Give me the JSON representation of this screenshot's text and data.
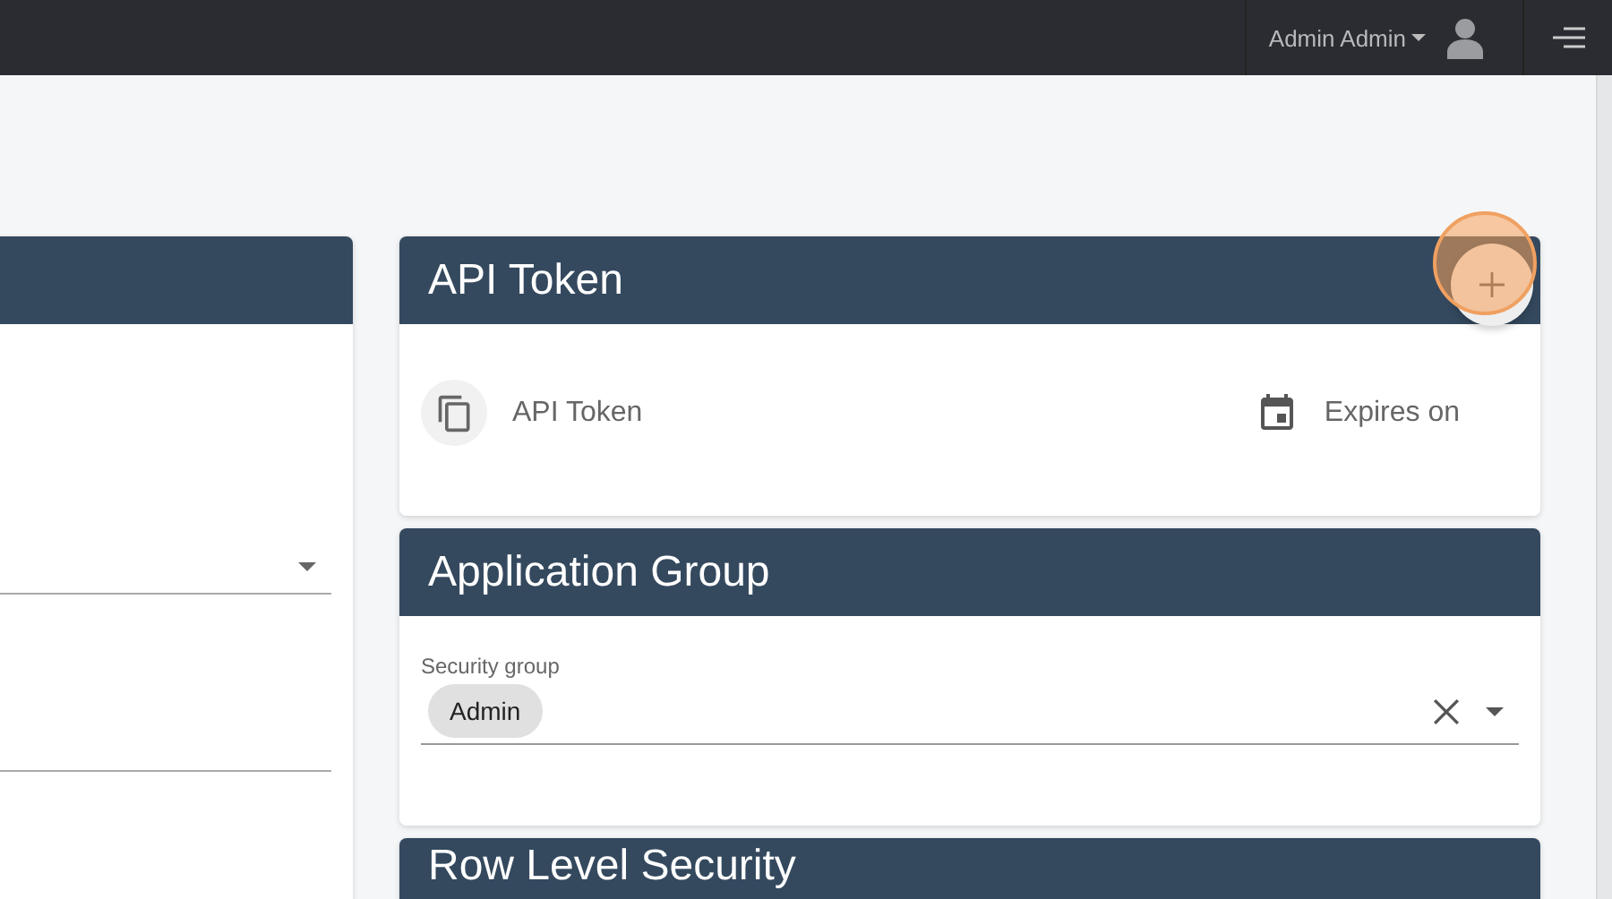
{
  "top_bar": {
    "user_name": "Admin Admin"
  },
  "api_token_card": {
    "title": "API Token",
    "columns": [
      "API Token",
      "Expires on"
    ]
  },
  "application_group_card": {
    "title": "Application Group",
    "field": {
      "label": "Security group",
      "chips": [
        "Admin"
      ]
    }
  },
  "row_level_security_card": {
    "title": "Row Level Security"
  }
}
